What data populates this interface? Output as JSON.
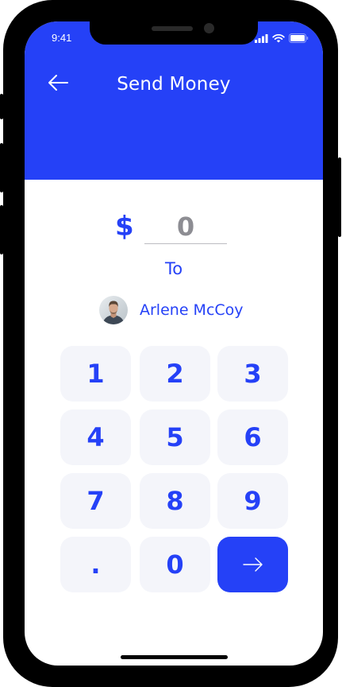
{
  "status_bar": {
    "time": "9:41",
    "icons": [
      "signal-icon",
      "wifi-icon",
      "battery-icon"
    ]
  },
  "header": {
    "title": "Send Money",
    "back_icon": "arrow-left-icon",
    "color": "#2541f7"
  },
  "amount": {
    "currency": "$",
    "value": "0"
  },
  "recipient": {
    "to_label": "To",
    "name": "Arlene McCoy"
  },
  "keypad": {
    "keys": [
      "1",
      "2",
      "3",
      "4",
      "5",
      "6",
      "7",
      "8",
      "9",
      ".",
      "0"
    ],
    "submit_icon": "arrow-right-icon"
  },
  "colors": {
    "accent": "#2541f7",
    "key_background": "#f4f5fa"
  }
}
